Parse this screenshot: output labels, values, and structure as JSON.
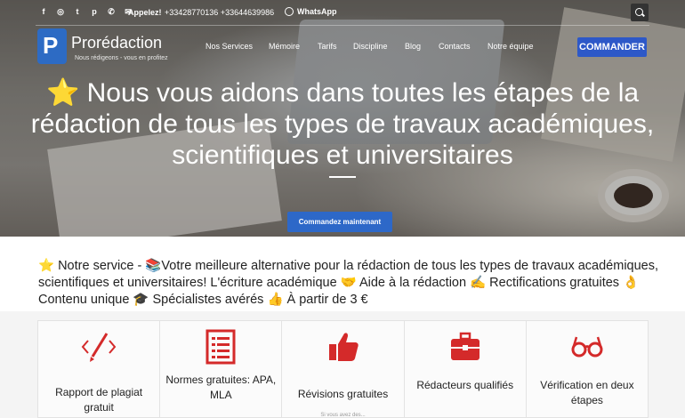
{
  "topbar": {
    "social_icons": [
      "facebook-icon",
      "instagram-icon",
      "twitter-icon",
      "pinterest-icon",
      "phone-icon",
      "mail-icon"
    ],
    "call_label": "Appelez!",
    "phones": "+33428770136  +33644639986",
    "whatsapp_label": "WhatsApp"
  },
  "brand": {
    "logo_letter": "P",
    "name": "Prorédaction",
    "tagline": "Nous rédigeons - vous en profitez"
  },
  "nav": {
    "items": [
      "Nos Services",
      "Mémoire",
      "Tarifs",
      "Discipline",
      "Blog",
      "Contacts",
      "Notre équipe"
    ],
    "commander_label": "COMMANDER"
  },
  "hero": {
    "star": "⭐",
    "title": "Nous vous aidons dans toutes les étapes de la rédaction de tous les types de travaux académiques, scientifiques et universitaires",
    "cta_label": "Commandez maintenant"
  },
  "service": {
    "text": "⭐ Notre service - 📚Votre meilleure alternative pour la rédaction de tous les types de travaux académiques, scientifiques et universitaires! L'écriture académique 🤝 Aide à la rédaction ✍ Rectifications gratuites 👌Contenu unique 🎓 Spécialistes avérés 👍 À partir de 3 €"
  },
  "cards": [
    {
      "icon": "code-pen-icon",
      "label": "Rapport de plagiat gratuit"
    },
    {
      "icon": "document-list-icon",
      "label": "Normes gratuites: APA, MLA"
    },
    {
      "icon": "thumbs-up-icon",
      "label": "Révisions gratuites",
      "sub": "Si vous avez des..."
    },
    {
      "icon": "briefcase-icon",
      "label": "Rédacteurs qualifiés"
    },
    {
      "icon": "glasses-icon",
      "label": "Vérification en deux étapes"
    }
  ],
  "colors": {
    "accent_blue": "#2d68c8",
    "icon_red": "#d42a2a",
    "star_yellow": "#f4b91c"
  }
}
